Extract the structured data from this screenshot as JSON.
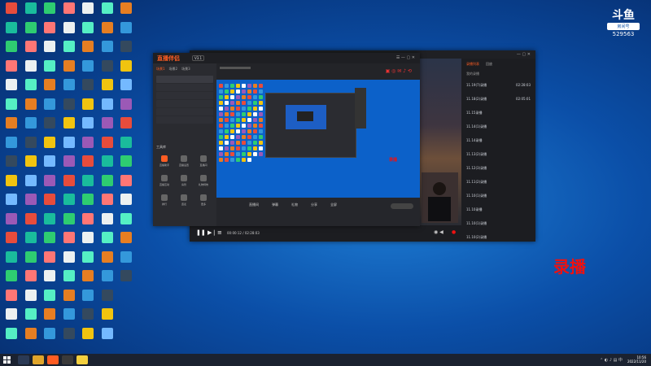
{
  "logo": {
    "glyph": "斗鱼",
    "subtitle": "房间号",
    "room": "529563"
  },
  "overlay": {
    "record": "录播",
    "small": "录播"
  },
  "streamer": {
    "title": "直播伴侣",
    "version": "V3.1",
    "scene_tabs": [
      "场景1",
      "场景2",
      "场景3"
    ],
    "tools_header": "工具库",
    "tools": [
      "直播助手",
      "直播设置",
      "直播间",
      "直播互动",
      "房管",
      "礼物特效",
      "排行",
      "连麦",
      "更多"
    ]
  },
  "player": {
    "time": "00:00:12 / 02:28:03",
    "bottom_labels": [
      "直播间",
      "弹幕",
      "礼物",
      "分享",
      "全屏"
    ]
  },
  "recordings": {
    "tabs": [
      "录播列表",
      "回放"
    ],
    "header": "我的录播",
    "items": [
      {
        "name": "11.19(7)录播",
        "meta": "02:28:03"
      },
      {
        "name": "11.18(2)录播",
        "meta": "02:05:01"
      },
      {
        "name": "11.15录播",
        "meta": ""
      },
      {
        "name": "11.14(1)录播",
        "meta": ""
      },
      {
        "name": "11.14录播",
        "meta": ""
      },
      {
        "name": "11.13(2)录播",
        "meta": ""
      },
      {
        "name": "11.12(3)录播",
        "meta": ""
      },
      {
        "name": "11.11(2)录播",
        "meta": ""
      },
      {
        "name": "11.10(1)录播",
        "meta": ""
      },
      {
        "name": "11.10录播",
        "meta": ""
      },
      {
        "name": "11.10(1)录播",
        "meta": ""
      },
      {
        "name": "11.10(2)录播",
        "meta": ""
      }
    ]
  },
  "taskbar": {
    "time": "10:56",
    "date": "2022/11/20"
  },
  "colors": {
    "brand": "#ff5d23",
    "desktop": "#0b4fa8",
    "red_text": "#e11"
  }
}
